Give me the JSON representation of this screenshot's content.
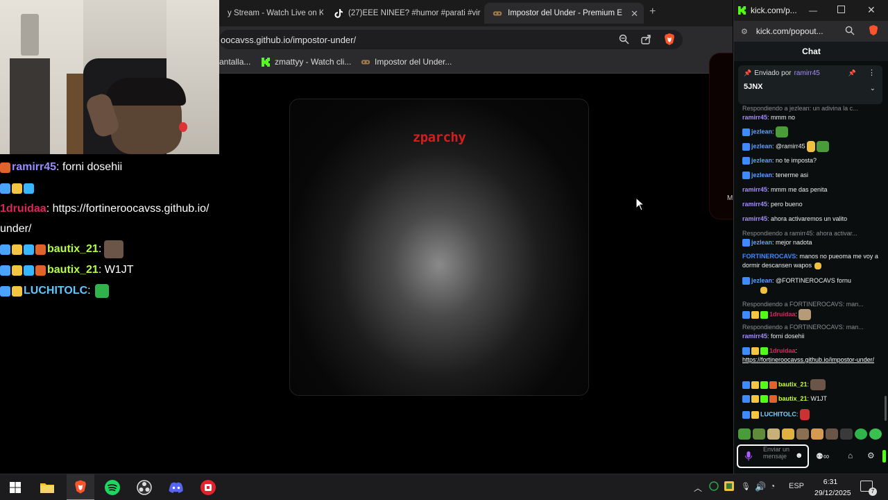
{
  "browser": {
    "tabs": [
      {
        "label": "y Stream - Watch Live on K",
        "icon": "kick-icon"
      },
      {
        "label": "(27)EEE NINEE? #humor #parati #vir",
        "icon": "tiktok-icon"
      },
      {
        "label": "Impostor del Under - Premium E",
        "icon": "game-icon",
        "active": true
      }
    ],
    "url": "oocavss.github.io/impostor-under/",
    "bookmarks": [
      {
        "label": "antalla...",
        "icon": ""
      },
      {
        "label": "zmattyy - Watch cli...",
        "icon": "kick-icon"
      },
      {
        "label": "Impostor del Under...",
        "icon": "game-icon"
      }
    ]
  },
  "game": {
    "title": "zparchy"
  },
  "overlay_chat": [
    {
      "user": "ramirr45",
      "user_color": "#9b8cff",
      "text": ": forni dosehii",
      "badges": [
        "#e0632b"
      ]
    },
    {
      "user": "",
      "user_color": "#fff",
      "text": "",
      "badges": [
        "#4aa3ff",
        "#f4c542",
        "#38b6ff"
      ]
    },
    {
      "user": "1druidaa",
      "user_color": "#e0245e",
      "text": ": https://fortineroocavss.github.io/",
      "badges": []
    },
    {
      "user": "",
      "user_color": "#fff",
      "text": "under/",
      "badges": []
    },
    {
      "user": "bautix_21",
      "user_color": "#b7ff3b",
      "text": ":",
      "badges": [
        "#4aa3ff",
        "#f4c542",
        "#38b6ff",
        "#e0632b"
      ]
    },
    {
      "user": "bautix_21",
      "user_color": "#b7ff3b",
      "text": ": W1JT",
      "badges": [
        "#4aa3ff",
        "#f4c542",
        "#38b6ff",
        "#e0632b"
      ]
    },
    {
      "user": "LUCHITOLC",
      "user_color": "#5ec8ff",
      "text": ":",
      "badges": [
        "#4aa3ff",
        "#f4c542"
      ]
    }
  ],
  "kick": {
    "title": "kick.com/p...",
    "address": "kick.com/popout...",
    "chat_header": "Chat",
    "pinned": {
      "label": "Enviado por",
      "user": "ramirr45",
      "message": "5JNX"
    },
    "messages": [
      {
        "type": "reply",
        "text": "Respondiendo a jezlean: un adivina la c..."
      },
      {
        "user": "ramirr45",
        "color": "#a58bff",
        "text": ": mmm no"
      },
      {
        "user": "jezlean",
        "color": "#5ea0ff",
        "text": ":"
      },
      {
        "user": "jezlean",
        "color": "#5ea0ff",
        "text": ": @ramirr45"
      },
      {
        "user": "jezlean",
        "color": "#5ea0ff",
        "text": ": no te imposta?"
      },
      {
        "user": "jezlean",
        "color": "#5ea0ff",
        "text": ": tenerme asi"
      },
      {
        "user": "ramirr45",
        "color": "#a58bff",
        "text": ": mmm me das penita"
      },
      {
        "user": "ramirr45",
        "color": "#a58bff",
        "text": ": pero bueno"
      },
      {
        "user": "ramirr45",
        "color": "#a58bff",
        "text": ": ahora activaremos un valito"
      },
      {
        "type": "reply",
        "text": "Respondiendo a ramirr45: ahora activar..."
      },
      {
        "user": "jezlean",
        "color": "#5ea0ff",
        "text": ": mejor nadota"
      },
      {
        "user": "FORTINEROCAVS",
        "color": "#3d8bff",
        "text": ": manos no pueoma me voy a dormir descansen wapos"
      },
      {
        "user": "jezlean",
        "color": "#5ea0ff",
        "text": ": @FORTINEROCAVS fornu"
      },
      {
        "type": "reply",
        "text": "Respondiendo a FORTINEROCAVS: man..."
      },
      {
        "user": "1druidaa",
        "color": "#e0245e",
        "text": ":"
      },
      {
        "type": "reply",
        "text": "Respondiendo a FORTINEROCAVS: man..."
      },
      {
        "user": "ramirr45",
        "color": "#a58bff",
        "text": ": forni dosehii"
      },
      {
        "user": "1druidaa",
        "color": "#e0245e",
        "text": ":"
      },
      {
        "link": "https://fortineroocavss.github.io/impostor-under/"
      },
      {
        "user": "bautix_21",
        "color": "#c7ff3b",
        "text": ":"
      },
      {
        "user": "bautix_21",
        "color": "#c7ff3b",
        "text": ": W1JT"
      },
      {
        "user": "LUCHITOLC",
        "color": "#7ad0ff",
        "text": ":"
      }
    ],
    "input_placeholder": "Enviar un mensaje"
  },
  "taskbar": {
    "apps": [
      "windows-start-icon",
      "file-explorer-icon",
      "brave-icon",
      "spotify-icon",
      "obs-icon",
      "discord-icon",
      "app-red-icon"
    ],
    "language": "ESP",
    "time": "6:31",
    "date": "29/12/2025",
    "notifications": "7"
  }
}
